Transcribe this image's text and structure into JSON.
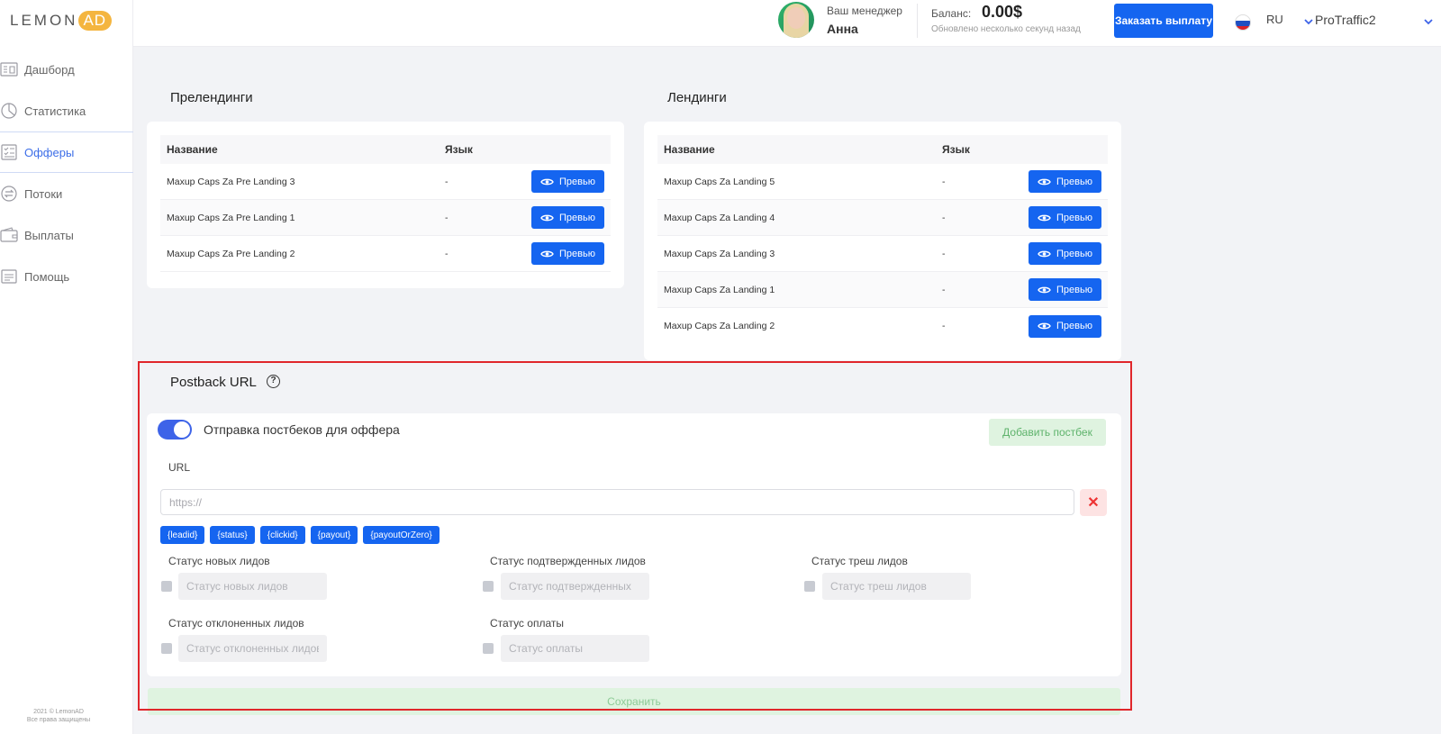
{
  "logo": {
    "left": "LEMON",
    "right": "AD"
  },
  "sidebar": {
    "items": [
      {
        "label": "Дашборд",
        "icon": "dashboard-icon",
        "active": false
      },
      {
        "label": "Статистика",
        "icon": "statistics-icon",
        "active": false
      },
      {
        "label": "Офферы",
        "icon": "offers-icon",
        "active": true
      },
      {
        "label": "Потоки",
        "icon": "flows-icon",
        "active": false
      },
      {
        "label": "Выплаты",
        "icon": "wallet-icon",
        "active": false
      },
      {
        "label": "Помощь",
        "icon": "help-icon",
        "active": false
      }
    ],
    "copyright_line1": "2021 © LemonAD",
    "copyright_line2": "Все права защищены"
  },
  "header": {
    "manager_label": "Ваш менеджер",
    "manager_name": "Анна",
    "balance_label": "Баланс:",
    "balance_value": "0.00$",
    "balance_updated": "Обновлено несколько секунд назад",
    "payout_button": "Заказать выплату",
    "language": "RU",
    "username": "ProTraffic2"
  },
  "prelandings": {
    "title": "Прелендинги",
    "col_name": "Название",
    "col_lang": "Язык",
    "rows": [
      {
        "name": "Maxup Caps Za Pre Landing 3",
        "lang": "-",
        "action": "Превью"
      },
      {
        "name": "Maxup Caps Za Pre Landing 1",
        "lang": "-",
        "action": "Превью"
      },
      {
        "name": "Maxup Caps Za Pre Landing 2",
        "lang": "-",
        "action": "Превью"
      }
    ]
  },
  "landings": {
    "title": "Лендинги",
    "col_name": "Название",
    "col_lang": "Язык",
    "rows": [
      {
        "name": "Maxup Caps Za Landing 5",
        "lang": "-",
        "action": "Превью"
      },
      {
        "name": "Maxup Caps Za Landing 4",
        "lang": "-",
        "action": "Превью"
      },
      {
        "name": "Maxup Caps Za Landing 3",
        "lang": "-",
        "action": "Превью"
      },
      {
        "name": "Maxup Caps Za Landing 1",
        "lang": "-",
        "action": "Превью"
      },
      {
        "name": "Maxup Caps Za Landing 2",
        "lang": "-",
        "action": "Превью"
      }
    ]
  },
  "postback": {
    "title": "Postback URL",
    "toggle_label": "Отправка постбеков для оффера",
    "toggle_on": true,
    "add_button": "Добавить постбек",
    "url_label": "URL",
    "url_placeholder": "https://",
    "url_value": "",
    "tags": [
      "{leadid}",
      "{status}",
      "{clickid}",
      "{payout}",
      "{payoutOrZero}"
    ],
    "status_new_label": "Статус новых лидов",
    "status_new_placeholder": "Статус новых лидов",
    "status_confirmed_label": "Статус подтвержденных лидов",
    "status_confirmed_placeholder": "Статус подтвержденных",
    "status_trash_label": "Статус треш лидов",
    "status_trash_placeholder": "Статус треш лидов",
    "status_rejected_label": "Статус отклоненных лидов",
    "status_rejected_placeholder": "Статус отклоненных лидов",
    "status_paid_label": "Статус оплаты",
    "status_paid_placeholder": "Статус оплаты",
    "save_button": "Сохранить"
  },
  "colors": {
    "accent": "#1565f0",
    "highlight": "#e0262b",
    "success_bg": "#dff3e0"
  }
}
